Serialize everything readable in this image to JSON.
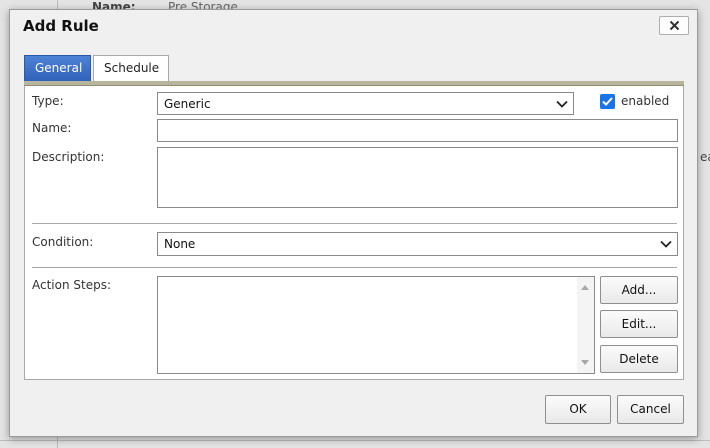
{
  "background": {
    "name_label": "Name:",
    "name_value": "Pre Storage",
    "partial_text": "ea"
  },
  "dialog": {
    "title": "Add Rule",
    "close_icon": "close-icon"
  },
  "tabs": [
    {
      "label": "General",
      "active": true
    },
    {
      "label": "Schedule",
      "active": false
    }
  ],
  "form": {
    "type_label": "Type:",
    "type_value": "Generic",
    "enabled_label": "enabled",
    "enabled_checked": true,
    "name_label": "Name:",
    "name_value": "",
    "description_label": "Description:",
    "description_value": "",
    "condition_label": "Condition:",
    "condition_value": "None",
    "action_steps_label": "Action Steps:"
  },
  "action_buttons": {
    "add": "Add...",
    "edit": "Edit...",
    "delete": "Delete"
  },
  "footer": {
    "ok": "OK",
    "cancel": "Cancel"
  },
  "colors": {
    "active_tab": "#3a6fc8",
    "checkbox": "#1a73e8"
  }
}
